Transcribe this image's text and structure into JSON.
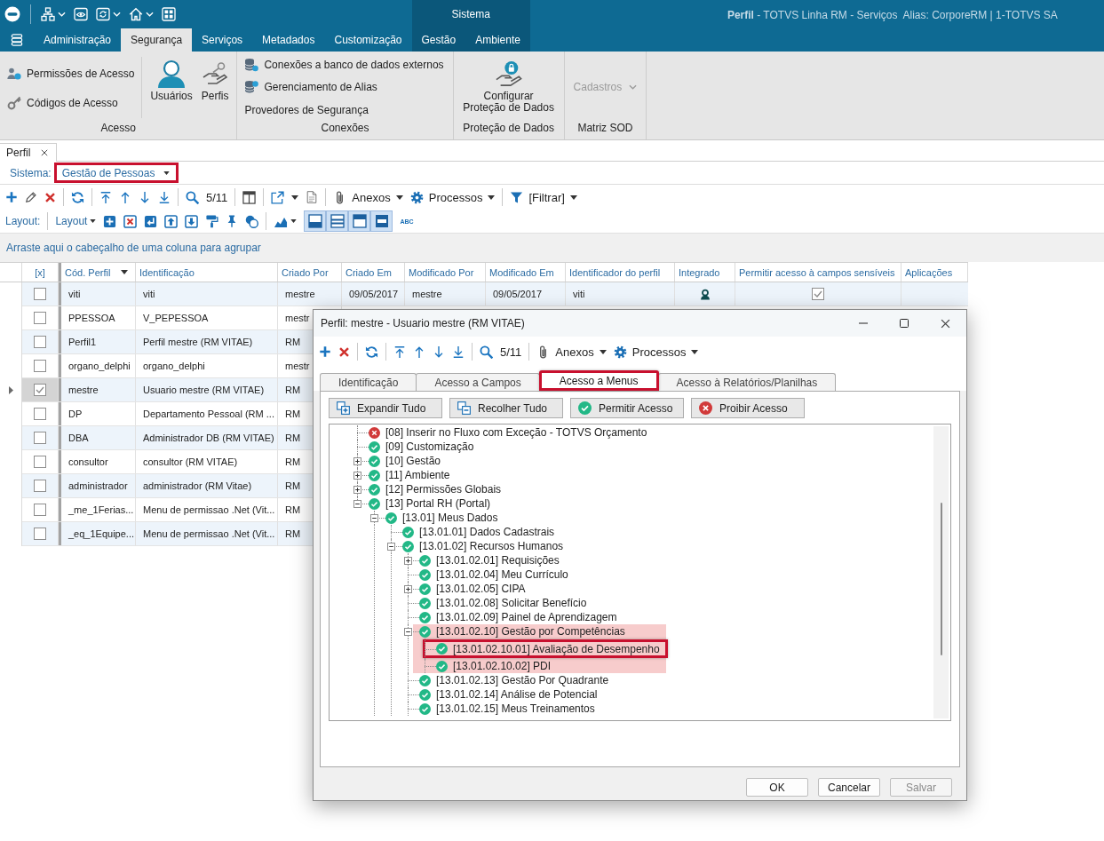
{
  "window": {
    "title": "**Perfil** - TOTVS Linha RM - Serviços  Alias: CorporeRM | 1-TOTVS SA"
  },
  "context_group": {
    "label": "Sistema"
  },
  "ribbon_tabs": [
    {
      "label": "Administração",
      "selected": false,
      "contextual": false
    },
    {
      "label": "Segurança",
      "selected": true,
      "contextual": false
    },
    {
      "label": "Serviços",
      "selected": false,
      "contextual": false
    },
    {
      "label": "Metadados",
      "selected": false,
      "contextual": false
    },
    {
      "label": "Customização",
      "selected": false,
      "contextual": false
    },
    {
      "label": "Gestão",
      "selected": false,
      "contextual": true
    },
    {
      "label": "Ambiente",
      "selected": false,
      "contextual": true
    }
  ],
  "ribbon_groups": [
    {
      "label": "Acesso",
      "items": [
        {
          "kind": "small",
          "label": "Permissões de Acesso"
        },
        {
          "kind": "small",
          "label": "Códigos de Acesso"
        },
        {
          "kind": "large",
          "label": "Usuários"
        },
        {
          "kind": "large",
          "label": "Perfis"
        }
      ]
    },
    {
      "label": "Conexões",
      "items": [
        {
          "kind": "small",
          "label": "Conexões a banco de dados externos"
        },
        {
          "kind": "small",
          "label": "Gerenciamento de Alias"
        },
        {
          "kind": "text",
          "label": "Provedores de Segurança"
        }
      ]
    },
    {
      "label": "Proteção de Dados",
      "items": [
        {
          "kind": "large",
          "label": "Configurar Proteção de Dados"
        }
      ]
    },
    {
      "label": "Matriz SOD",
      "items": [
        {
          "kind": "dropdown",
          "label": "Cadastros",
          "disabled": true
        }
      ]
    }
  ],
  "document_tab": {
    "label": "Perfil",
    "closable": true
  },
  "filter_bar": {
    "label": "Sistema:",
    "value": "Gestão de Pessoas",
    "highlighted": true
  },
  "toolbar": {
    "record_position": "5/11",
    "buttons": [
      {
        "label": "Anexos"
      },
      {
        "label": "Processos"
      },
      {
        "label": "[Filtrar]"
      }
    ]
  },
  "layout_toolbar": {
    "label": "Layout:",
    "menu": "Layout",
    "view_toggles": [
      {
        "on": true
      },
      {
        "on": true
      },
      {
        "on": true
      },
      {
        "on": true
      }
    ],
    "text_button": "ABC"
  },
  "group_panel": {
    "text": "Arraste aqui o cabeçalho de uma coluna para agrupar"
  },
  "table": {
    "check_column": "[x]",
    "columns": [
      "Cód. Perfil",
      "Identificação",
      "Criado Por",
      "Criado Em",
      "Modificado Por",
      "Modificado Em",
      "Identificador do perfil",
      "Integrado",
      "Permitir acesso à campos sensíveis",
      "Aplicações"
    ],
    "rows": [
      {
        "selected": false,
        "checked": false,
        "cells": [
          "viti",
          "viti",
          "mestre",
          "09/05/2017",
          "mestre",
          "09/05/2017",
          "viti"
        ],
        "integrated": true,
        "sensitive_access": true
      },
      {
        "selected": false,
        "checked": false,
        "cells": [
          "PPESSOA",
          "V_PEPESSOA",
          "mestr"
        ]
      },
      {
        "selected": false,
        "checked": false,
        "cells": [
          "Perfil1",
          "Perfil mestre (RM VITAE)",
          "RM"
        ]
      },
      {
        "selected": false,
        "checked": false,
        "cells": [
          "organo_delphi",
          "organo_delphi",
          "mestr"
        ]
      },
      {
        "selected": true,
        "checked": true,
        "cells": [
          "mestre",
          "Usuario mestre (RM VITAE)",
          "RM"
        ]
      },
      {
        "selected": false,
        "checked": false,
        "cells": [
          "DP",
          "Departamento Pessoal (RM ...",
          "RM"
        ]
      },
      {
        "selected": false,
        "checked": false,
        "cells": [
          "DBA",
          "Administrador DB (RM VITAE)",
          "RM"
        ]
      },
      {
        "selected": false,
        "checked": false,
        "cells": [
          "consultor",
          "consultor (RM VITAE)",
          "RM"
        ]
      },
      {
        "selected": false,
        "checked": false,
        "cells": [
          "administrador",
          "administrador (RM Vitae)",
          "RM"
        ]
      },
      {
        "selected": false,
        "checked": false,
        "cells": [
          "_me_1Ferias...",
          "Menu de permissao .Net (Vit...",
          "RM"
        ]
      },
      {
        "selected": false,
        "checked": false,
        "cells": [
          "_eq_1Equipe...",
          "Menu de permissao .Net (Vit...",
          "RM"
        ]
      }
    ]
  },
  "dialog": {
    "title": "Perfil: mestre - Usuario mestre (RM VITAE)",
    "toolbar": {
      "record_position": "5/11",
      "buttons": [
        {
          "label": "Anexos"
        },
        {
          "label": "Processos"
        }
      ]
    },
    "tabs": [
      {
        "label": "Identificação",
        "selected": false
      },
      {
        "label": "Acesso a Campos",
        "selected": false
      },
      {
        "label": "Acesso a Menus",
        "selected": true,
        "highlighted": true
      },
      {
        "label": "Acesso à Relatórios/Planilhas",
        "selected": false
      }
    ],
    "actions": [
      {
        "label": "Expandir Tudo"
      },
      {
        "label": "Recolher Tudo"
      },
      {
        "label": "Permitir Acesso"
      },
      {
        "label": "Proibir Acesso"
      }
    ],
    "tree": [
      {
        "label": "[08] Inserir no Fluxo com Exceção - TOTVS Orçamento",
        "allowed": false
      },
      {
        "label": "[09] Customização",
        "allowed": true
      },
      {
        "label": "[10] Gestão",
        "allowed": true,
        "expanded": false
      },
      {
        "label": "[11] Ambiente",
        "allowed": true,
        "expanded": false
      },
      {
        "label": "[12] Permissões Globais",
        "allowed": true,
        "expanded": false
      },
      {
        "label": "[13] Portal RH (Portal)",
        "allowed": true,
        "expanded": true,
        "children": [
          {
            "label": "[13.01] Meus Dados",
            "allowed": true,
            "expanded": true,
            "children": [
              {
                "label": "[13.01.01] Dados Cadastrais",
                "allowed": true
              },
              {
                "label": "[13.01.02] Recursos Humanos",
                "allowed": true,
                "expanded": true,
                "children": [
                  {
                    "label": "[13.01.02.01] Requisições",
                    "allowed": true,
                    "expanded": false
                  },
                  {
                    "label": "[13.01.02.04] Meu Currículo",
                    "allowed": true
                  },
                  {
                    "label": "[13.01.02.05] CIPA",
                    "allowed": true,
                    "expanded": false
                  },
                  {
                    "label": "[13.01.02.08] Solicitar Benefício",
                    "allowed": true
                  },
                  {
                    "label": "[13.01.02.09] Painel de Aprendizagem",
                    "allowed": true
                  },
                  {
                    "label": "[13.01.02.10] Gestão por Competências",
                    "allowed": true,
                    "expanded": true,
                    "shaded": true,
                    "children": [
                      {
                        "label": "[13.01.02.10.01] Avaliação de Desempenho",
                        "allowed": true,
                        "highlighted": true
                      },
                      {
                        "label": "[13.01.02.10.02] PDI",
                        "allowed": true
                      }
                    ]
                  },
                  {
                    "label": "[13.01.02.13] Gestão Por Quadrante",
                    "allowed": true
                  },
                  {
                    "label": "[13.01.02.14] Análise de Potencial",
                    "allowed": true
                  },
                  {
                    "label": "[13.01.02.15] Meus Treinamentos",
                    "allowed": true
                  }
                ]
              }
            ]
          }
        ]
      }
    ],
    "buttons": [
      {
        "label": "OK",
        "disabled": false
      },
      {
        "label": "Cancelar",
        "disabled": false
      },
      {
        "label": "Salvar",
        "disabled": true
      }
    ]
  }
}
